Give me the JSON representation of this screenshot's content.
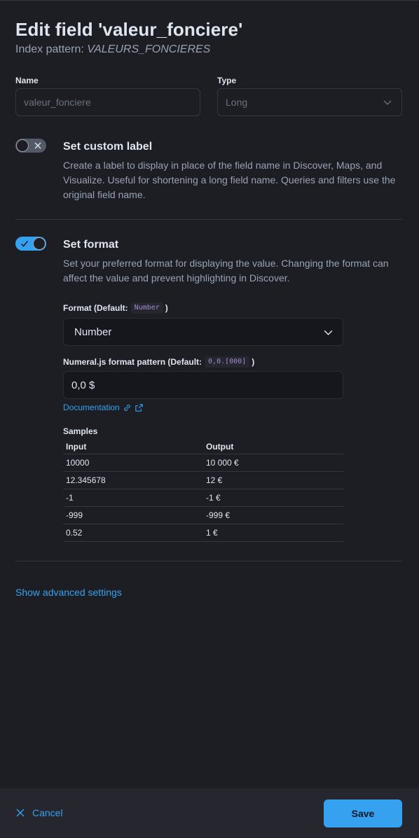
{
  "header": {
    "title": "Edit field 'valeur_fonciere'",
    "subtitle_prefix": "Index pattern:",
    "index_pattern": "VALEURS_FONCIERES"
  },
  "name_field": {
    "label": "Name",
    "value": "valeur_fonciere"
  },
  "type_field": {
    "label": "Type",
    "value": "Long"
  },
  "custom_label": {
    "enabled": false,
    "title": "Set custom label",
    "description": "Create a label to display in place of the field name in Discover, Maps, and Visualize. Useful for shortening a long field name. Queries and filters use the original field name."
  },
  "format_section": {
    "enabled": true,
    "title": "Set format",
    "description": "Set your preferred format for displaying the value. Changing the format can affect the value and prevent highlighting in Discover.",
    "format_label_prefix": "Format (Default:",
    "format_default": "Number",
    "format_label_suffix": ")",
    "format_value": "Number",
    "pattern_label_prefix": "Numeral.js format pattern (Default:",
    "pattern_default": "0,0.[000]",
    "pattern_label_suffix": ")",
    "pattern_value": "0,0 $",
    "doc_link": "Documentation"
  },
  "samples": {
    "label": "Samples",
    "headers": [
      "Input",
      "Output"
    ],
    "rows": [
      [
        "10000",
        "10 000 €"
      ],
      [
        "12.345678",
        "12 €"
      ],
      [
        "-1",
        "-1 €"
      ],
      [
        "-999",
        "-999 €"
      ],
      [
        "0.52",
        "1 €"
      ]
    ]
  },
  "advanced_link": "Show advanced settings",
  "footer": {
    "cancel": "Cancel",
    "save": "Save"
  },
  "colors": {
    "accent": "#36a2ef",
    "background": "#1d1e24",
    "footer": "#25262e"
  }
}
